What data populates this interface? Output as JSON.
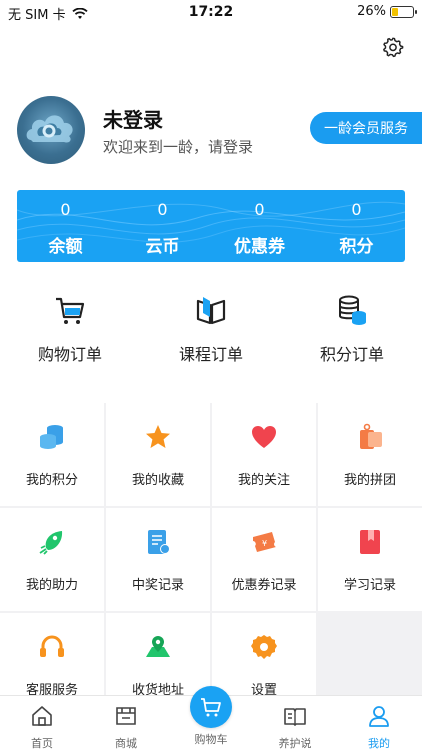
{
  "status_bar": {
    "carrier": "无 SIM 卡",
    "time": "17:22",
    "battery": "26%"
  },
  "profile": {
    "name": "未登录",
    "welcome": "欢迎来到一龄，请登录",
    "member_button": "一龄会员服务"
  },
  "stats": [
    {
      "value": "0",
      "label": "余额"
    },
    {
      "value": "0",
      "label": "云币"
    },
    {
      "value": "0",
      "label": "优惠券"
    },
    {
      "value": "0",
      "label": "积分"
    }
  ],
  "orders": [
    {
      "label": "购物订单",
      "icon": "shopping-cart-icon"
    },
    {
      "label": "课程订单",
      "icon": "book-icon"
    },
    {
      "label": "积分订单",
      "icon": "coins-icon"
    }
  ],
  "grid": [
    {
      "label": "我的积分",
      "icon": "coins-stack-icon"
    },
    {
      "label": "我的收藏",
      "icon": "star-icon"
    },
    {
      "label": "我的关注",
      "icon": "heart-icon"
    },
    {
      "label": "我的拼团",
      "icon": "tag-group-icon"
    },
    {
      "label": "我的助力",
      "icon": "boost-icon"
    },
    {
      "label": "中奖记录",
      "icon": "prize-record-icon"
    },
    {
      "label": "优惠券记录",
      "icon": "coupon-icon"
    },
    {
      "label": "学习记录",
      "icon": "bookmark-icon"
    },
    {
      "label": "客服服务",
      "icon": "headset-icon"
    },
    {
      "label": "收货地址",
      "icon": "map-pin-icon"
    },
    {
      "label": "设置",
      "icon": "gear-icon"
    }
  ],
  "tabs": [
    {
      "label": "首页",
      "icon": "home-icon"
    },
    {
      "label": "商城",
      "icon": "store-icon"
    },
    {
      "label": "购物车",
      "icon": "cart-icon"
    },
    {
      "label": "养护说",
      "icon": "open-book-icon"
    },
    {
      "label": "我的",
      "icon": "user-icon"
    }
  ],
  "colors": {
    "accent": "#1a9cf0",
    "stats_card": "#1aa2f3"
  }
}
